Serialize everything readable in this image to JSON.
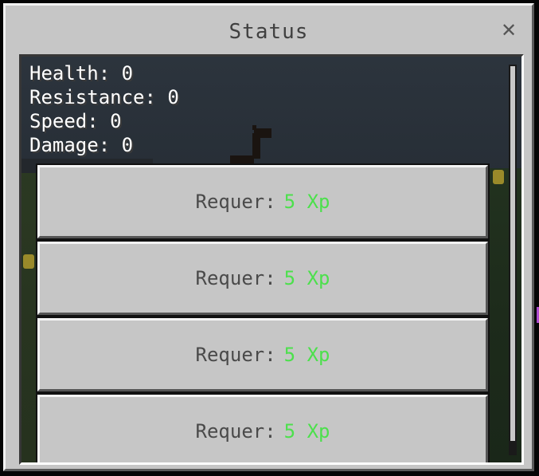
{
  "dialog": {
    "title": "Status",
    "close_symbol": "✕"
  },
  "stats": [
    {
      "label": "Health:",
      "value": "0"
    },
    {
      "label": "Resistance:",
      "value": "0"
    },
    {
      "label": "Speed:",
      "value": "0"
    },
    {
      "label": "Damage:",
      "value": "0"
    }
  ],
  "upgrades": [
    {
      "label": "Requer:",
      "cost": "5 Xp"
    },
    {
      "label": "Requer:",
      "cost": "5 Xp"
    },
    {
      "label": "Requer:",
      "cost": "5 Xp"
    },
    {
      "label": "Requer:",
      "cost": "5 Xp"
    }
  ],
  "colors": {
    "panel": "#c6c6c6",
    "cost_text": "#4ce04c",
    "title_text": "#404040"
  },
  "icons": {
    "close": "close-icon"
  }
}
